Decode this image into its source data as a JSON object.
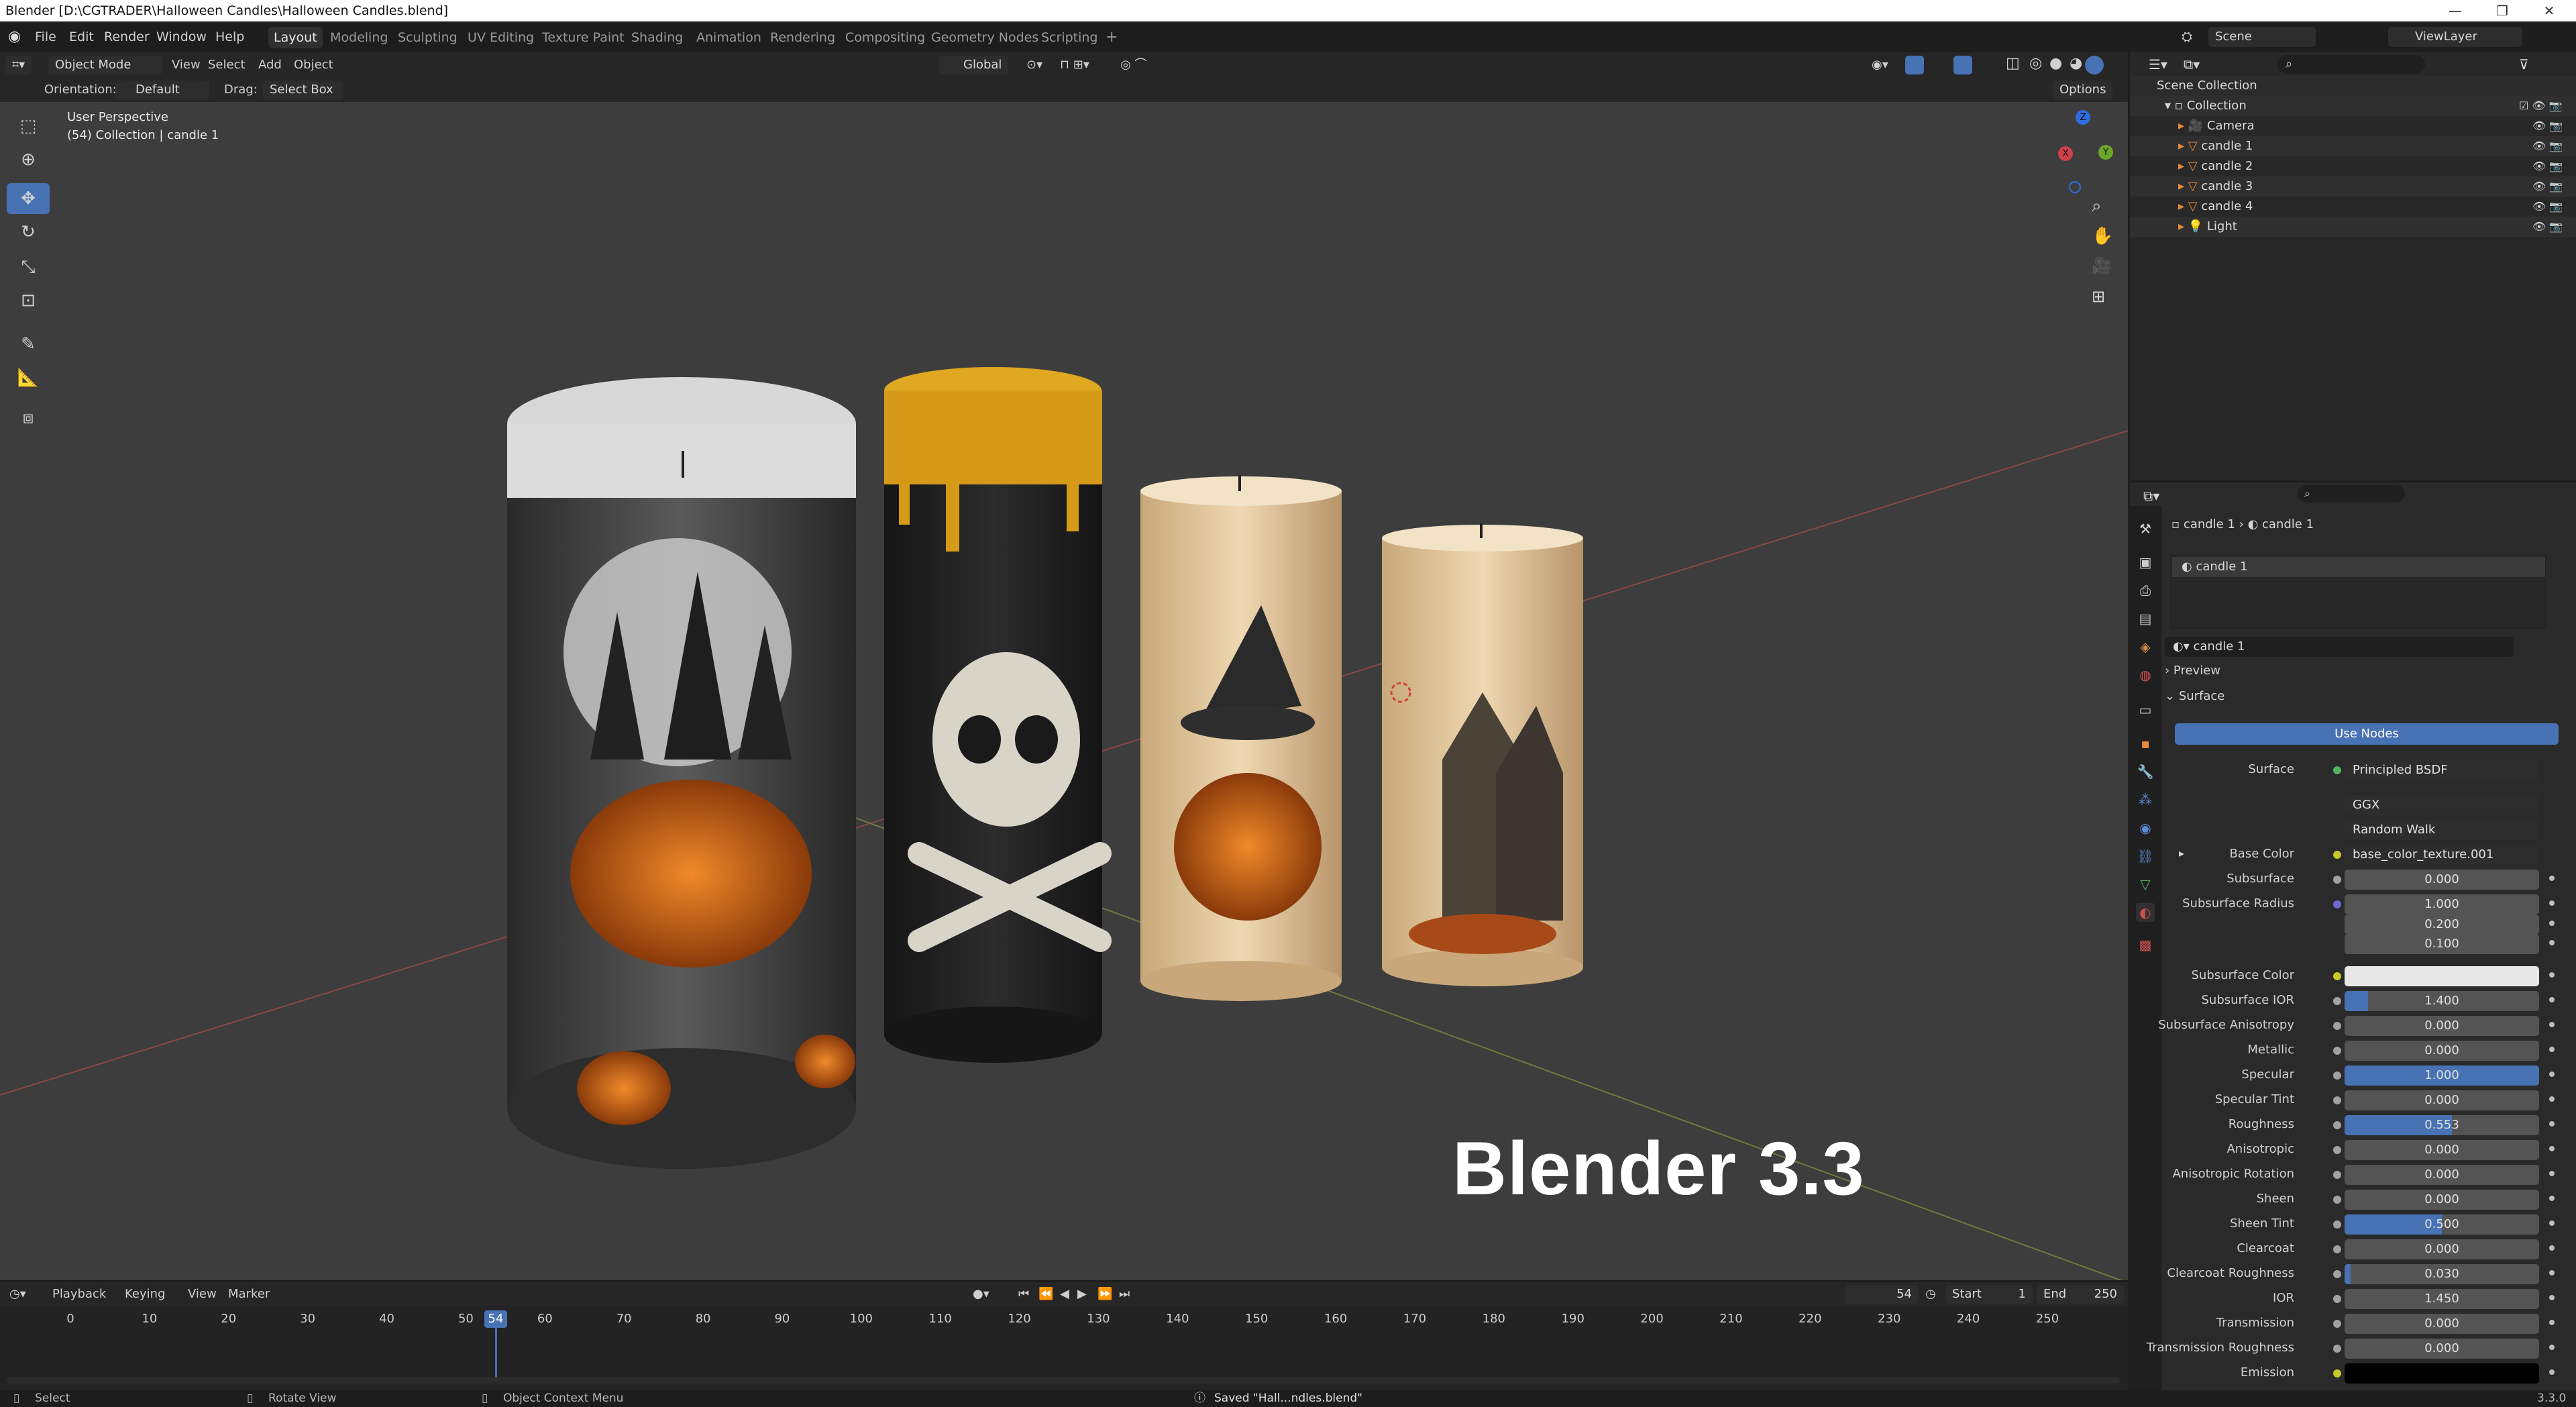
{
  "window": {
    "title": "Blender [D:\\CGTRADER\\Halloween Candles\\Halloween Candles.blend]"
  },
  "menu": [
    "File",
    "Edit",
    "Render",
    "Window",
    "Help"
  ],
  "workspaces": [
    "Layout",
    "Modeling",
    "Sculpting",
    "UV Editing",
    "Texture Paint",
    "Shading",
    "Animation",
    "Rendering",
    "Compositing",
    "Geometry Nodes",
    "Scripting"
  ],
  "active_workspace": "Layout",
  "scene": {
    "name": "Scene",
    "view_layer": "ViewLayer"
  },
  "viewport_header": {
    "mode": "Object Mode",
    "menus": [
      "View",
      "Select",
      "Add",
      "Object"
    ],
    "transform_orientation": "Global",
    "orientation_label": "Orientation:",
    "orientation_value": "Default",
    "drag_label": "Drag:",
    "drag_value": "Select Box",
    "options": "Options"
  },
  "viewport": {
    "perspective": "User Perspective",
    "collection_info": "(54) Collection | candle 1",
    "overlay_text": "Blender 3.3"
  },
  "outliner": {
    "root": "Scene Collection",
    "collection": "Collection",
    "items": [
      {
        "name": "Camera",
        "icon": "camera-icon"
      },
      {
        "name": "candle 1",
        "icon": "mesh-icon"
      },
      {
        "name": "candle 2",
        "icon": "mesh-icon"
      },
      {
        "name": "candle 3",
        "icon": "mesh-icon"
      },
      {
        "name": "candle 4",
        "icon": "mesh-icon"
      },
      {
        "name": "Light",
        "icon": "light-icon"
      }
    ]
  },
  "properties": {
    "breadcrumb": [
      "candle 1",
      "candle 1"
    ],
    "material_slot": "candle 1",
    "material_name": "candle 1",
    "panels": {
      "preview": "Preview",
      "surface": "Surface"
    },
    "use_nodes": "Use Nodes",
    "surface_label": "Surface",
    "surface_shader": "Principled BSDF",
    "distribution": "GGX",
    "subsurface_method": "Random Walk",
    "base_color_label": "Base Color",
    "base_color_texture": "base_color_texture.001",
    "fields": [
      {
        "label": "Subsurface",
        "value": "0.000",
        "fill": 0
      },
      {
        "label": "Subsurface Radius",
        "value": "1.000",
        "fill": 0
      },
      {
        "label": "",
        "value": "0.200",
        "fill": 0
      },
      {
        "label": "",
        "value": "0.100",
        "fill": 0
      },
      {
        "label": "Subsurface Color",
        "value": "",
        "fill": 0,
        "swatch": "#e8e8e8"
      },
      {
        "label": "Subsurface IOR",
        "value": "1.400",
        "fill": 0.12
      },
      {
        "label": "Subsurface Anisotropy",
        "value": "0.000",
        "fill": 0
      },
      {
        "label": "Metallic",
        "value": "0.000",
        "fill": 0
      },
      {
        "label": "Specular",
        "value": "1.000",
        "fill": 1
      },
      {
        "label": "Specular Tint",
        "value": "0.000",
        "fill": 0
      },
      {
        "label": "Roughness",
        "value": "0.553",
        "fill": 0.553
      },
      {
        "label": "Anisotropic",
        "value": "0.000",
        "fill": 0
      },
      {
        "label": "Anisotropic Rotation",
        "value": "0.000",
        "fill": 0
      },
      {
        "label": "Sheen",
        "value": "0.000",
        "fill": 0
      },
      {
        "label": "Sheen Tint",
        "value": "0.500",
        "fill": 0.5
      },
      {
        "label": "Clearcoat",
        "value": "0.000",
        "fill": 0
      },
      {
        "label": "Clearcoat Roughness",
        "value": "0.030",
        "fill": 0.03
      },
      {
        "label": "IOR",
        "value": "1.450",
        "fill": 0
      },
      {
        "label": "Transmission",
        "value": "0.000",
        "fill": 0
      },
      {
        "label": "Transmission Roughness",
        "value": "0.000",
        "fill": 0
      },
      {
        "label": "Emission",
        "value": "",
        "fill": 0,
        "swatch": "#000000"
      }
    ]
  },
  "timeline": {
    "menus": [
      "Playback",
      "Keying",
      "View",
      "Marker"
    ],
    "current_frame": "54",
    "start_label": "Start",
    "start": "1",
    "end_label": "End",
    "end": "250",
    "ticks": [
      "0",
      "10",
      "20",
      "30",
      "40",
      "50",
      "60",
      "70",
      "80",
      "90",
      "100",
      "110",
      "120",
      "130",
      "140",
      "150",
      "160",
      "170",
      "180",
      "190",
      "200",
      "210",
      "220",
      "230",
      "240",
      "250"
    ]
  },
  "statusbar": {
    "select": "Select",
    "rotate": "Rotate View",
    "context": "Object Context Menu",
    "message": "Saved \"Hall...ndles.blend\"",
    "version": "3.3.0"
  },
  "colors": {
    "accent": "#4772b3",
    "bg": "#303030",
    "viewport": "#3d3d3d"
  }
}
